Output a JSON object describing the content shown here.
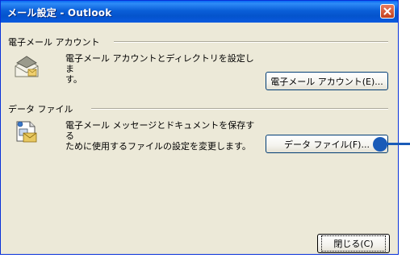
{
  "window": {
    "title": "メール設定 - Outlook"
  },
  "email_accounts": {
    "group_label": "電子メール アカウント",
    "description_line1": "電子メール アカウントとディレクトリを設定しま",
    "description_line2": "す。",
    "button_label": "電子メール アカウント(E)..."
  },
  "data_files": {
    "group_label": "データ ファイル",
    "description_line1": "電子メール メッセージとドキュメントを保存する",
    "description_line2": "ために使用するファイルの設定を変更します。",
    "button_label": "データ ファイル(F)..."
  },
  "footer": {
    "close_label": "閉じる(C)"
  },
  "icons": {
    "close": "close-icon",
    "mail_account": "mail-account-icon",
    "data_file": "data-file-icon",
    "annotation": "annotation-marker"
  },
  "colors": {
    "titlebar": "#0453cc",
    "window_bg": "#ece9d8",
    "annotation": "#1a5bb8"
  }
}
